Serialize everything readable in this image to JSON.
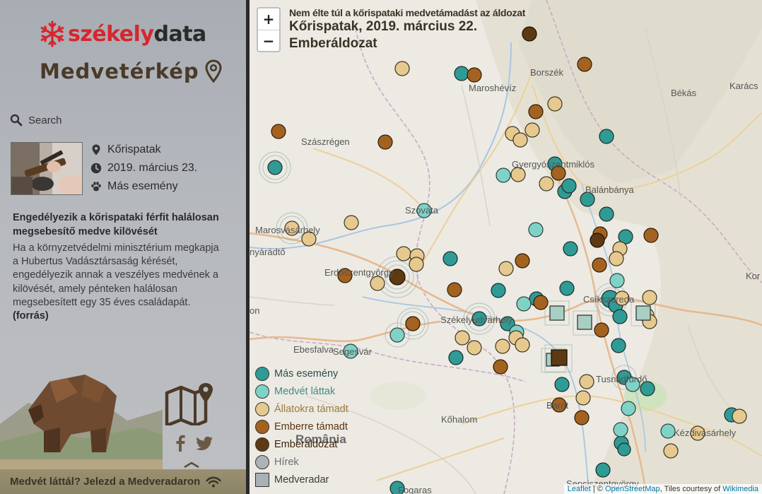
{
  "brand": {
    "part_a": "székely",
    "part_b": "data",
    "snowflake_color": "#d7262c"
  },
  "app": {
    "title": "Medvetérkép"
  },
  "search": {
    "placeholder": "Search"
  },
  "event": {
    "location": "Kőrispatak",
    "date": "2019. március 23.",
    "type": "Más esemény",
    "photo_icon": "bear-hunter-photo"
  },
  "article": {
    "title": "Engedélyezik a kőrispataki férfit halálosan megsebesítő medve kilövését",
    "body": "Ha a környzetvédelmi minisztérium megkapja a Hubertus Vadásztársaság kérését, engedélyezik annak a veszélyes medvének a kilövését, amely pénteken halálosan megsebesített egy 35 éves családapát.",
    "source_label": "(forrás)"
  },
  "footer": {
    "report_label": "Medvét láttál? Jelezd a Medveradaron"
  },
  "map": {
    "zoom_in": "+",
    "zoom_out": "−",
    "headline": {
      "top": "Nem élte túl a kőrispataki medvetámadást az áldozat",
      "line1": "Kőrispatak, 2019. március 22.",
      "line2": "Emberáldozat"
    },
    "places": {
      "borszek": "Borszék",
      "maroshevíz": "Maroshévíz",
      "bekas": "Békás",
      "karacs": "Karács",
      "szaszregen": "Szászrégen",
      "gyergyo": "Gyergyószentmiklós",
      "balanbanya": "Balánbánya",
      "szovata": "Szováta",
      "marosvasarhely": "Marosvásárhely",
      "nyaradto": "nyárádtő",
      "erdoszentgyorgy": "Erdőszentgyörgy",
      "kor": "Kor",
      "szekelyudvarhely": "Székelyudvarhely",
      "csikszereda": "Csíkszereda",
      "on": "on",
      "ebesfalva": "Ebesfalva",
      "segesvar": "Segesvár",
      "tusnadfurdo": "Tusnádfürdő",
      "baroth": "Barót",
      "kohalom": "Kőhalom",
      "romania": "România",
      "kezdivasarhely": "Kézdivásárhely",
      "sepsiszentgyorgy": "Sepsiszentgyörgy",
      "fogaras": "Fogaras"
    },
    "legend": [
      {
        "label": "Más esemény",
        "color": "#2f9b95",
        "text_color": "#2a4f4c",
        "shape": "circle"
      },
      {
        "label": "Medvét láttak",
        "color": "#7fd3c6",
        "text_color": "#3e8c84",
        "shape": "circle"
      },
      {
        "label": "Állatokra támadt",
        "color": "#e6c98f",
        "text_color": "#9a7b3e",
        "shape": "circle"
      },
      {
        "label": "Emberre támadt",
        "color": "#a3621f",
        "text_color": "#5a3510",
        "shape": "circle"
      },
      {
        "label": "Emberáldozat",
        "color": "#5d3a12",
        "text_color": "#3d2409",
        "shape": "circle"
      },
      {
        "label": "Hírek",
        "color": "#aeb3b8",
        "text_color": "#6b7077",
        "shape": "circle"
      },
      {
        "label": "Medveradar",
        "color": "#a9b0b6",
        "text_color": "#3a3a3a",
        "shape": "square"
      }
    ],
    "attribution": {
      "leaflet": "Leaflet",
      "sep": " | © ",
      "osm": "OpenStreetMap",
      "tiles": ", Tiles courtesy of ",
      "wiki": "Wikimedia"
    }
  }
}
